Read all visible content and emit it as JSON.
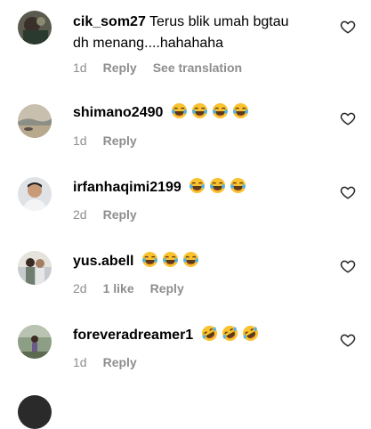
{
  "comments": [
    {
      "username": "cik_som27",
      "text_line1": "Terus blik umah bgtau",
      "text_line2": "dh menang....hahahaha",
      "emoji": "",
      "emoji_count": 0,
      "time": "1d",
      "likes": "",
      "reply": "Reply",
      "translate": "See translation"
    },
    {
      "username": "shimano2490",
      "emoji": "laughing-tears",
      "emoji_count": 4,
      "time": "1d",
      "likes": "",
      "reply": "Reply"
    },
    {
      "username": "irfanhaqimi2199",
      "emoji": "laughing-tears",
      "emoji_count": 3,
      "time": "2d",
      "likes": "",
      "reply": "Reply"
    },
    {
      "username": "yus.abell",
      "emoji": "laughing-tears",
      "emoji_count": 3,
      "time": "2d",
      "likes": "1 like",
      "reply": "Reply"
    },
    {
      "username": "foreveradreamer1",
      "emoji": "rolling-laughing",
      "emoji_count": 3,
      "time": "1d",
      "likes": "",
      "reply": "Reply"
    }
  ],
  "icons": {
    "like": "heart-outline-icon"
  },
  "colors": {
    "meta_text": "#8e8e8e",
    "emoji_yellow": "#f9c22e"
  }
}
